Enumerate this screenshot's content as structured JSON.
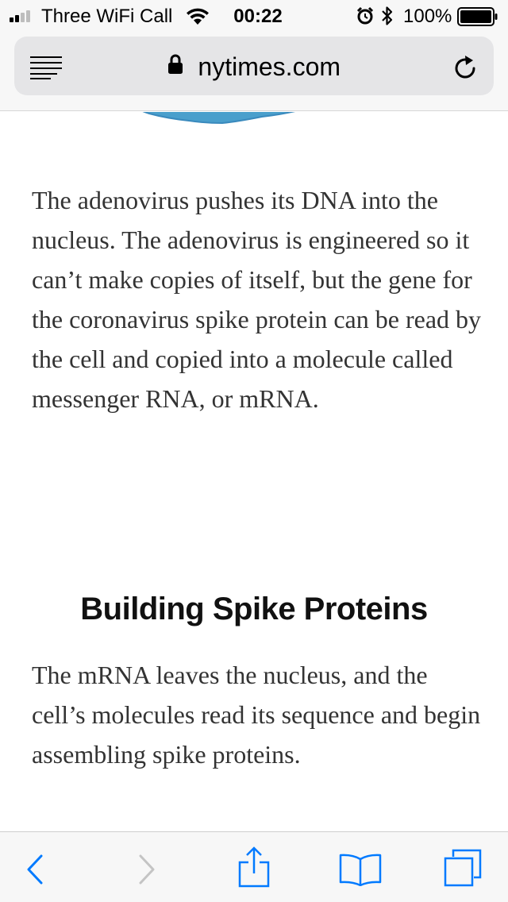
{
  "status_bar": {
    "carrier": "Three WiFi Call",
    "time": "00:22",
    "battery_percent": "100%",
    "battery_level": 1.0,
    "signal_bars": 2,
    "icons": [
      "signal-icon",
      "wifi-icon",
      "alarm-icon",
      "bluetooth-icon",
      "battery-icon"
    ]
  },
  "address_bar": {
    "url": "nytimes.com",
    "secure": true,
    "icons": [
      "reader-view-icon",
      "lock-icon",
      "reload-icon"
    ]
  },
  "article": {
    "paragraph_1": "The adenovirus pushes its DNA into the nucleus. The adenovirus is engineered so it can’t make copies of itself, but the gene for the coronavirus spike protein can be read by the cell and copied into a molecule called messenger RNA, or mRNA.",
    "heading": "Building Spike Proteins",
    "paragraph_2": "The mRNA leaves the nucleus, and the cell’s molecules read its sequence and begin assembling spike proteins."
  },
  "toolbar": {
    "items": [
      "back-icon",
      "forward-icon",
      "share-icon",
      "bookmarks-icon",
      "tabs-icon"
    ]
  },
  "colors": {
    "accent": "#007aff",
    "disabled": "#c4c4c4",
    "illustration_blue": "#4a9fcc",
    "body_text": "#333333"
  }
}
